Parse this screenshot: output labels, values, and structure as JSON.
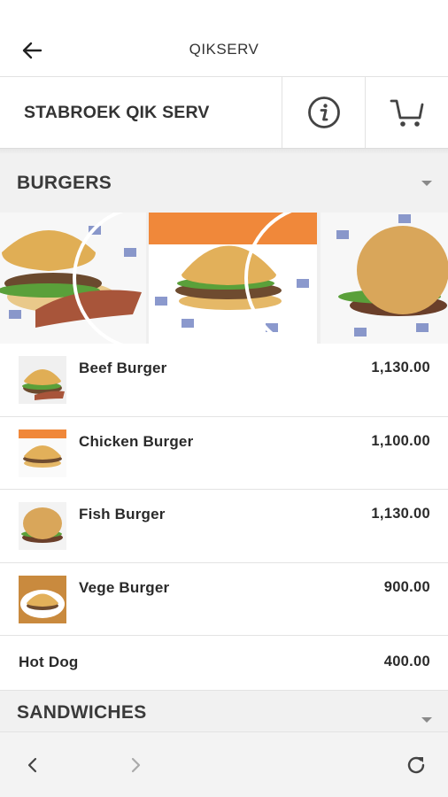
{
  "appbar": {
    "title": "QIKSERV",
    "back_icon": "arrow-left-icon"
  },
  "store": {
    "name": "STABROEK QIK SERV",
    "info_icon": "info-icon",
    "cart_icon": "cart-icon"
  },
  "categories": [
    {
      "label": "BURGERS",
      "expanded": true
    },
    {
      "label": "SANDWICHES",
      "expanded": false
    }
  ],
  "items": [
    {
      "name": "Beef Burger",
      "price": "1,130.00",
      "has_image": true
    },
    {
      "name": "Chicken Burger",
      "price": "1,100.00",
      "has_image": true
    },
    {
      "name": "Fish Burger",
      "price": "1,130.00",
      "has_image": true
    },
    {
      "name": "Vege Burger",
      "price": "900.00",
      "has_image": true
    },
    {
      "name": "Hot Dog",
      "price": "400.00",
      "has_image": false
    }
  ],
  "bottombar": {
    "back_icon": "chevron-left-icon",
    "forward_icon": "chevron-right-icon",
    "refresh_icon": "refresh-icon"
  },
  "colors": {
    "accent": "#333333",
    "header_bg": "#f1f1f1",
    "divider": "#e3e3e3"
  }
}
